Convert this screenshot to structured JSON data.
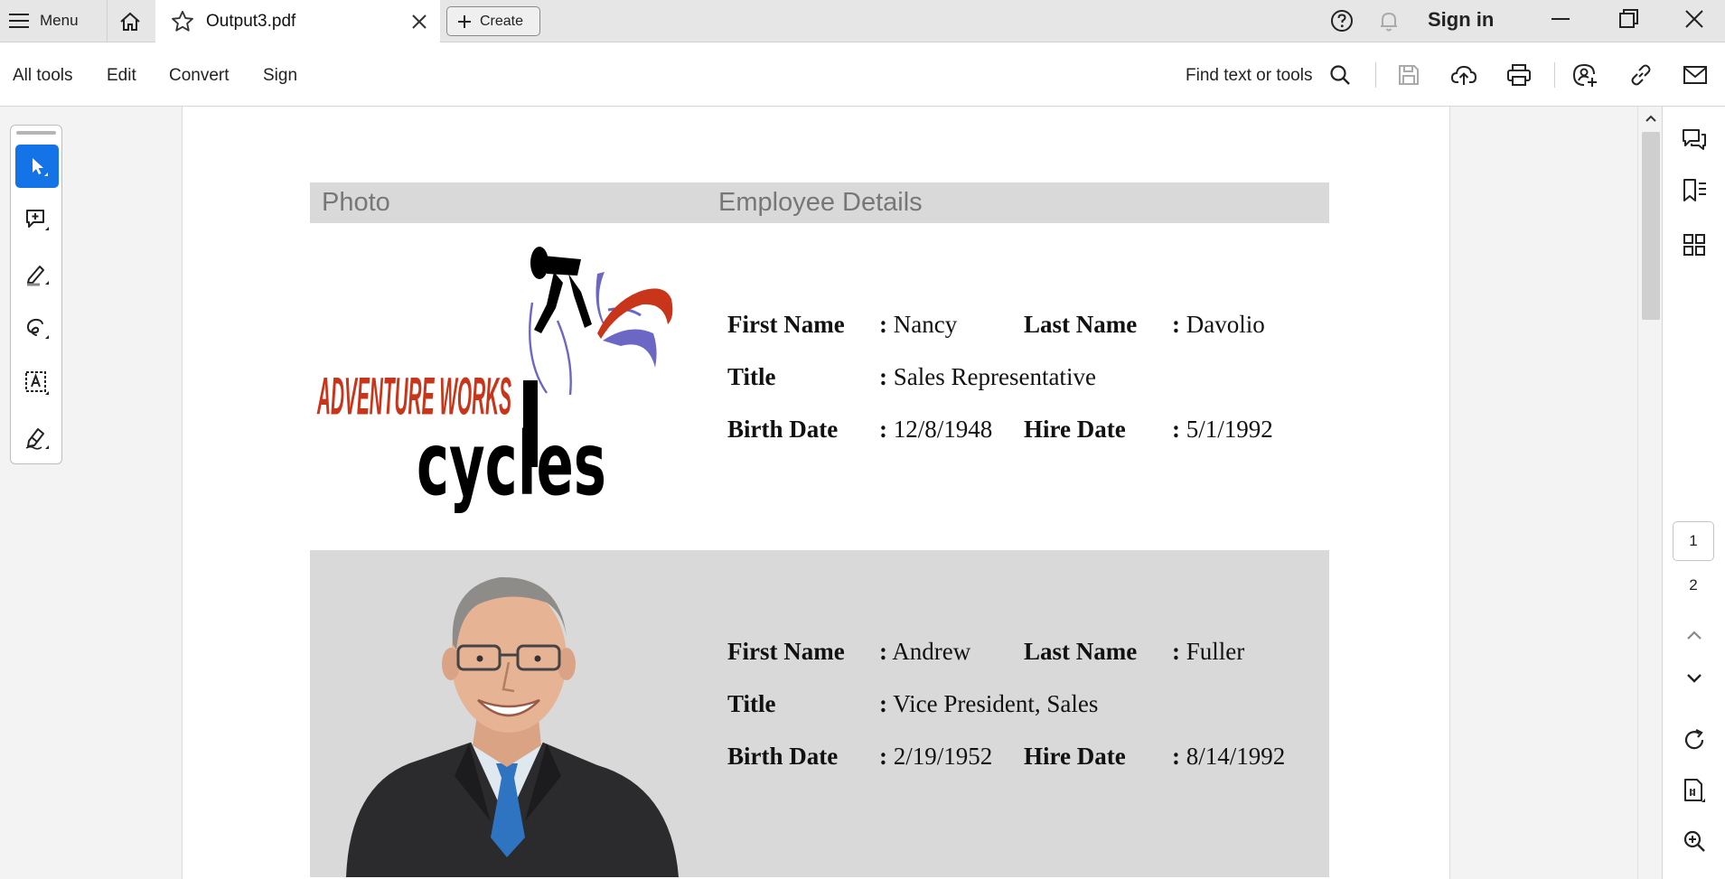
{
  "titlebar": {
    "menu_label": "Menu",
    "tab_title": "Output3.pdf",
    "create_label": "Create",
    "signin_label": "Sign in"
  },
  "toolbar": {
    "items": [
      "All tools",
      "Edit",
      "Convert",
      "Sign"
    ],
    "find_label": "Find text or tools"
  },
  "document": {
    "header": {
      "photo": "Photo",
      "details": "Employee Details"
    },
    "logo": {
      "line1": "ADVENTURE WORKS",
      "line2": "cycles"
    },
    "labels": {
      "first_name": "First Name",
      "last_name": "Last Name",
      "title": "Title",
      "birth_date": "Birth Date",
      "hire_date": "Hire Date",
      "sep": ":"
    },
    "employees": [
      {
        "first_name": "Nancy",
        "last_name": "Davolio",
        "title": "Sales Representative",
        "birth_date": "12/8/1948",
        "hire_date": "5/1/1992"
      },
      {
        "first_name": "Andrew",
        "last_name": "Fuller",
        "title": "Vice President, Sales",
        "birth_date": "2/19/1952",
        "hire_date": "8/14/1992"
      }
    ]
  },
  "navigation": {
    "pages": [
      "1",
      "2"
    ],
    "current_page": "1"
  },
  "colors": {
    "accent": "#1473e6",
    "row_shade": "#d9d9d9",
    "logo_red": "#c8351a",
    "logo_purple": "#6c67c4"
  }
}
